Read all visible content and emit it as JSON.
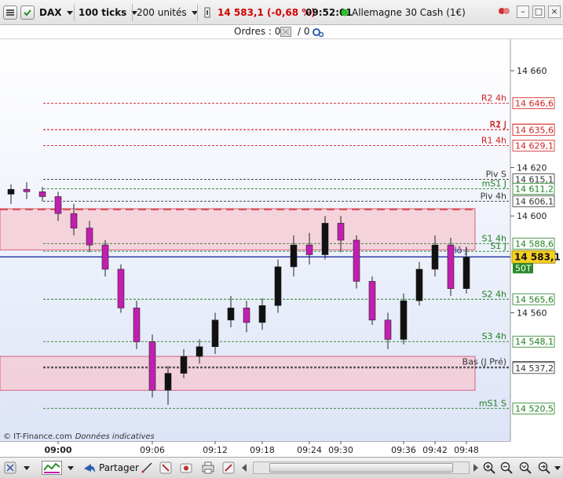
{
  "toolbar": {
    "instrument": "DAX",
    "ticks": "100 ticks",
    "units": "200 unités",
    "quote": "14 583,1 (-0,68 %)",
    "time": "09:52:01",
    "market_name": "Allemagne 30 Cash (1€)"
  },
  "orders": {
    "label": "Ordres : 0",
    "count": "/ 0"
  },
  "footer": {
    "copyright": "© IT-Finance.com",
    "note": "Données indicatives",
    "share_label": "Partager"
  },
  "colors": {
    "bull": "#111111",
    "bear": "#c21fb0",
    "resistance": "#d02020",
    "support": "#208020",
    "pivot": "#333333",
    "zone": "#f5c8d2",
    "blue_line": "#2030a0"
  },
  "chart_data": {
    "type": "candlestick",
    "ylim": [
      14507,
      14673
    ],
    "y_ticks": [
      {
        "value": 14660,
        "label": "14 660"
      },
      {
        "value": 14620,
        "label": "14 620"
      },
      {
        "value": 14600,
        "label": "14 600"
      },
      {
        "value": 14560,
        "label": "14 560"
      }
    ],
    "x_ticks": [
      {
        "index": 3,
        "label": "09:00"
      },
      {
        "index": 9,
        "label": "09:06"
      },
      {
        "index": 13,
        "label": "09:12"
      },
      {
        "index": 16,
        "label": "09:18"
      },
      {
        "index": 19,
        "label": "09:24"
      },
      {
        "index": 21,
        "label": "09:30"
      },
      {
        "index": 25,
        "label": "09:36"
      },
      {
        "index": 27,
        "label": "09:42"
      },
      {
        "index": 29,
        "label": "09:48"
      }
    ],
    "levels": [
      {
        "name": "R2 4h",
        "value": 14646.6,
        "label": "14 646,6",
        "kind": "resistance"
      },
      {
        "name": "R2 J",
        "value": 14635.7,
        "label": "14 635,7",
        "kind": "resistance"
      },
      {
        "name": "R1 J",
        "value": 14635.6,
        "label": "14 635,6",
        "kind": "resistance"
      },
      {
        "name": "R1 4h",
        "value": 14629.1,
        "label": "14 629,1",
        "kind": "resistance"
      },
      {
        "name": "Piv S",
        "value": 14615.1,
        "label": "14 615,1",
        "kind": "pivot"
      },
      {
        "name": "mS1 J",
        "value": 14611.2,
        "label": "14 611,2",
        "kind": "support"
      },
      {
        "name": "Piv 4h",
        "value": 14606.1,
        "label": "14 606,1",
        "kind": "pivot"
      },
      {
        "name": "S1 4h",
        "value": 14588.6,
        "label": "14 588,6",
        "kind": "support"
      },
      {
        "name": "S1 J",
        "value": 14585.4,
        "label": "",
        "kind": "support"
      },
      {
        "name": "S2 4h",
        "value": 14565.6,
        "label": "14 565,6",
        "kind": "support"
      },
      {
        "name": "S3 4h",
        "value": 14548.1,
        "label": "14 548,1",
        "kind": "support"
      },
      {
        "name": "Bas (J Pré)",
        "value": 14537.6,
        "label": "14 537,6",
        "kind": "pivot"
      },
      {
        "name": "",
        "value": 14537.2,
        "label": "14 537,2",
        "kind": "pivot"
      },
      {
        "name": "mS1 S",
        "value": 14520.5,
        "label": "14 520,5",
        "kind": "support"
      }
    ],
    "current_price": {
      "value": 14583.1,
      "label": "14 583,1",
      "volume": "50T"
    },
    "close_label": "Clô J",
    "zones": [
      {
        "from": 14586,
        "to": 14603
      },
      {
        "from": 14528,
        "to": 14542
      }
    ],
    "candles": [
      {
        "o": 14609,
        "h": 14613,
        "l": 14605,
        "c": 14611
      },
      {
        "o": 14611,
        "h": 14614,
        "l": 14607,
        "c": 14610
      },
      {
        "o": 14610,
        "h": 14612,
        "l": 14606,
        "c": 14608
      },
      {
        "o": 14608,
        "h": 14610,
        "l": 14598,
        "c": 14601
      },
      {
        "o": 14601,
        "h": 14605,
        "l": 14592,
        "c": 14595
      },
      {
        "o": 14595,
        "h": 14598,
        "l": 14585,
        "c": 14588
      },
      {
        "o": 14588,
        "h": 14590,
        "l": 14575,
        "c": 14578
      },
      {
        "o": 14578,
        "h": 14580,
        "l": 14560,
        "c": 14562
      },
      {
        "o": 14562,
        "h": 14565,
        "l": 14545,
        "c": 14548
      },
      {
        "o": 14548,
        "h": 14551,
        "l": 14525,
        "c": 14528
      },
      {
        "o": 14528,
        "h": 14538,
        "l": 14522,
        "c": 14535
      },
      {
        "o": 14535,
        "h": 14545,
        "l": 14533,
        "c": 14542
      },
      {
        "o": 14542,
        "h": 14549,
        "l": 14539,
        "c": 14546
      },
      {
        "o": 14546,
        "h": 14560,
        "l": 14543,
        "c": 14557
      },
      {
        "o": 14557,
        "h": 14567,
        "l": 14554,
        "c": 14562
      },
      {
        "o": 14562,
        "h": 14565,
        "l": 14552,
        "c": 14556
      },
      {
        "o": 14556,
        "h": 14566,
        "l": 14553,
        "c": 14563
      },
      {
        "o": 14563,
        "h": 14582,
        "l": 14560,
        "c": 14579
      },
      {
        "o": 14579,
        "h": 14592,
        "l": 14575,
        "c": 14588
      },
      {
        "o": 14588,
        "h": 14593,
        "l": 14580,
        "c": 14584
      },
      {
        "o": 14584,
        "h": 14600,
        "l": 14582,
        "c": 14597
      },
      {
        "o": 14597,
        "h": 14600,
        "l": 14585,
        "c": 14590
      },
      {
        "o": 14590,
        "h": 14592,
        "l": 14570,
        "c": 14573
      },
      {
        "o": 14573,
        "h": 14575,
        "l": 14555,
        "c": 14557
      },
      {
        "o": 14557,
        "h": 14560,
        "l": 14545,
        "c": 14549
      },
      {
        "o": 14549,
        "h": 14568,
        "l": 14547,
        "c": 14565
      },
      {
        "o": 14565,
        "h": 14581,
        "l": 14563,
        "c": 14578
      },
      {
        "o": 14578,
        "h": 14592,
        "l": 14575,
        "c": 14588
      },
      {
        "o": 14588,
        "h": 14591,
        "l": 14567,
        "c": 14570
      },
      {
        "o": 14570,
        "h": 14587,
        "l": 14568,
        "c": 14583
      }
    ]
  }
}
